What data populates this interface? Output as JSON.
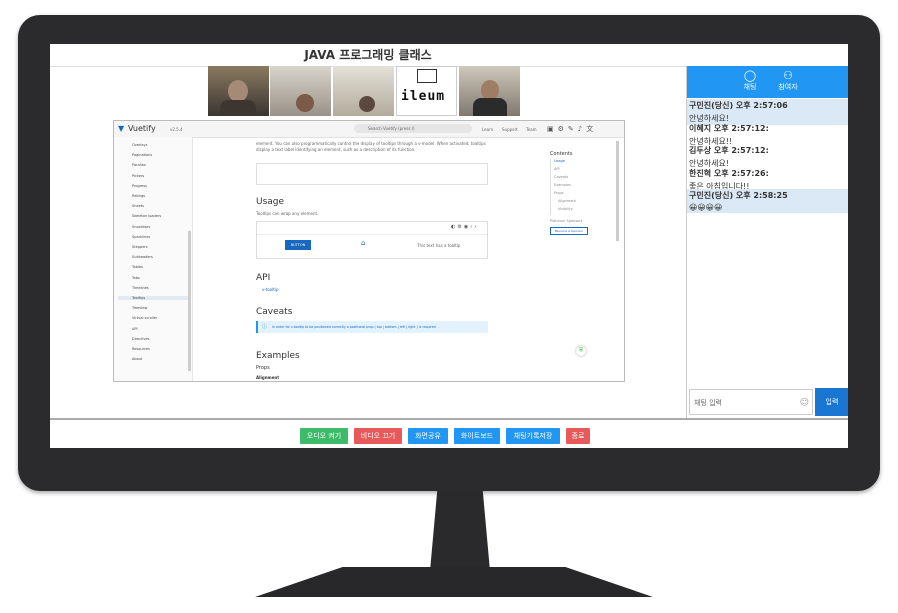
{
  "page_title": "JAVA 프로그래밍 클래스",
  "participant_tiles": [
    "",
    "",
    "",
    "ileum",
    ""
  ],
  "chat": {
    "tabs": [
      {
        "label": "채팅",
        "icon": "chat-bubble-icon"
      },
      {
        "label": "참여자",
        "icon": "participants-icon"
      }
    ],
    "messages": [
      {
        "name": "구민진(당신) 오후 2:57:06",
        "text": "안녕하세요!",
        "highlight": true
      },
      {
        "name": "이혜지 오후 2:57:12:",
        "text": "안녕하세요!!",
        "highlight": false
      },
      {
        "name": "김두상 오후 2:57:12:",
        "text": "안녕하세요!",
        "highlight": false
      },
      {
        "name": "한진혁 오후 2:57:26:",
        "text": "좋은 아침입니다!!",
        "highlight": false
      },
      {
        "name": "구민진(당신) 오후 2:58:25",
        "text": "😀😀😀😀",
        "highlight": true
      }
    ],
    "input_placeholder": "채팅 입력",
    "send_label": "입력"
  },
  "controls": [
    {
      "label": "오디오 켜기",
      "color": "#3dbb6b"
    },
    {
      "label": "비디오 끄기",
      "color": "#e85a5a"
    },
    {
      "label": "화면공유",
      "color": "#2196f3"
    },
    {
      "label": "화이트보드",
      "color": "#2196f3"
    },
    {
      "label": "채팅기록저장",
      "color": "#2196f3"
    },
    {
      "label": "종료",
      "color": "#e85a5a"
    }
  ],
  "vuetify": {
    "logo": "Vuetify",
    "version": "v2.5.4",
    "search_placeholder": "Search Vuetify (press /)",
    "topnav": [
      "Learn",
      "Support",
      "Team"
    ],
    "nav_items": [
      "Overlays",
      "Paginations",
      "Parallax",
      "Pickers",
      "Progress",
      "Ratings",
      "Sheets",
      "Skeleton loaders",
      "Snackbars",
      "Sparklines",
      "Steppers",
      "Subheaders",
      "Tables",
      "Tabs",
      "Timelines",
      "Tooltips",
      "Treeview",
      "Virtual scroller",
      "API",
      "Directives",
      "Resources",
      "About"
    ],
    "intro_text": "element. You can also programmatically control the display of tooltips through a v-model. When activated, tooltips display a text label identifying an element, such as a description of its function.",
    "usage_heading": "Usage",
    "usage_text": "Tooltips can wrap any element.",
    "demo_button": "BUTTON",
    "demo_text": "This text has a tooltip",
    "api_heading": "API",
    "api_link": "v-tooltip",
    "caveats_heading": "Caveats",
    "caveat_text": "In order for v-tooltip to be positioned correctly a positional prop ( top | bottom | left | right ) is required",
    "examples_heading": "Examples",
    "props_label": "Props",
    "alignment_label": "Alignment",
    "toc_title": "Contents",
    "toc_items": [
      "Usage",
      "API",
      "Caveats",
      "Examples",
      "Props",
      "Alignment",
      "Visibility"
    ],
    "sponsor_label": "Platinum Sponsors",
    "sponsor_button": "Become a Sponsor"
  }
}
